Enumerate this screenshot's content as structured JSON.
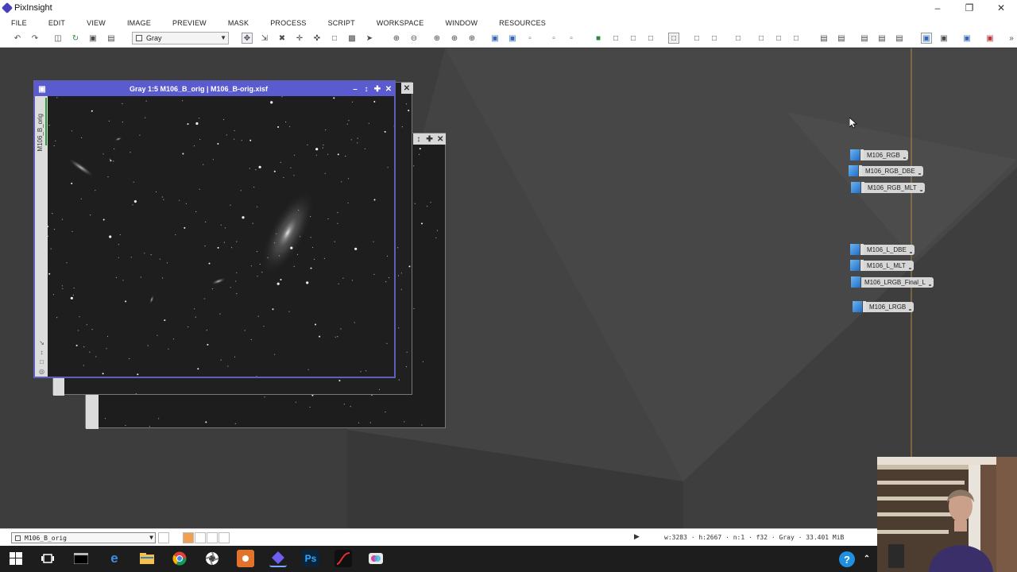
{
  "app": {
    "title": "PixInsight"
  },
  "menu": [
    "FILE",
    "EDIT",
    "VIEW",
    "IMAGE",
    "PREVIEW",
    "MASK",
    "PROCESS",
    "SCRIPT",
    "WORKSPACE",
    "WINDOW",
    "RESOURCES"
  ],
  "toolbar": {
    "color_mode": "Gray"
  },
  "image_window": {
    "title": "Gray 1:5 M106_B_orig | M106_B-orig.xisf",
    "view_id": "M106_B_orig"
  },
  "image_icons": [
    {
      "label": "M106_RGB"
    },
    {
      "label": "M106_RGB_DBE"
    },
    {
      "label": "M106_RGB_MLT"
    },
    {
      "label": "M106_L_DBE"
    },
    {
      "label": "M106_L_MLT"
    },
    {
      "label": "M106_LRGB_Final_L"
    },
    {
      "label": "M106_LRGB"
    }
  ],
  "statusbar": {
    "view_selector": "M106_B_orig",
    "info": "w:3283 · h:2667 · n:1 · f32 · Gray · 33.401 MiB"
  },
  "taskbar": {
    "photoshop_label": "Ps"
  }
}
